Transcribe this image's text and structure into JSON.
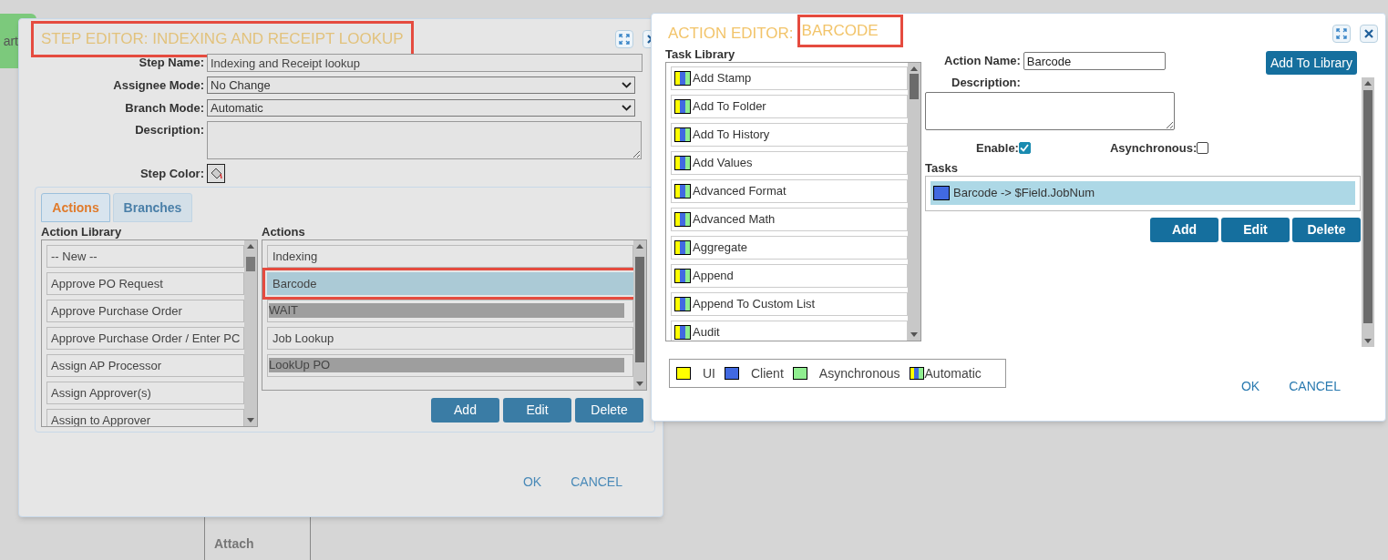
{
  "canvas": {
    "nodes": [
      {
        "kind": "start",
        "label": "art"
      },
      {
        "kind": "step",
        "label": "Attach"
      }
    ]
  },
  "step_editor": {
    "title": "STEP EDITOR: INDEXING AND RECEIPT LOOKUP",
    "title_highlighted": true,
    "fields": [
      {
        "kind": "text",
        "label": "Step Name:",
        "value": "Indexing and Receipt lookup"
      },
      {
        "kind": "select",
        "label": "Assignee Mode:",
        "value": "No Change"
      },
      {
        "kind": "select",
        "label": "Branch Mode:",
        "value": "Automatic"
      },
      {
        "kind": "textarea",
        "label": "Description:"
      },
      {
        "kind": "color",
        "label": "Step Color:"
      }
    ],
    "tabs": [
      {
        "label": "Actions",
        "selected": true
      },
      {
        "label": "Branches",
        "selected": false
      }
    ],
    "action_library": {
      "title": "Action Library",
      "items": [
        "-- New --",
        "Approve PO Request",
        "Approve Purchase Order",
        "Approve Purchase Order / Enter PC",
        "Assign AP Processor",
        "Assign Approver(s)",
        "Assign to Approver"
      ]
    },
    "actions": {
      "title": "Actions",
      "items": [
        {
          "label": "Indexing",
          "selected": false,
          "disabled": false,
          "highlighted": false
        },
        {
          "label": "Barcode",
          "selected": true,
          "disabled": false,
          "highlighted": true
        },
        {
          "label": "WAIT",
          "selected": false,
          "disabled": true,
          "highlighted": false
        },
        {
          "label": "Job Lookup",
          "selected": false,
          "disabled": false,
          "highlighted": false
        },
        {
          "label": "LookUp PO",
          "selected": false,
          "disabled": true,
          "highlighted": false
        }
      ]
    },
    "buttons": [
      "Add",
      "Edit",
      "Delete"
    ],
    "footer": [
      "OK",
      "CANCEL"
    ]
  },
  "action_editor": {
    "title_prefix": "ACTION EDITOR:",
    "title_name": "BARCODE",
    "name_highlighted": true,
    "task_library": {
      "title": "Task Library",
      "items": [
        {
          "label": "Add Stamp",
          "kind": "automatic"
        },
        {
          "label": "Add To Folder",
          "kind": "automatic"
        },
        {
          "label": "Add To History",
          "kind": "automatic"
        },
        {
          "label": "Add Values",
          "kind": "automatic"
        },
        {
          "label": "Advanced Format",
          "kind": "automatic"
        },
        {
          "label": "Advanced Math",
          "kind": "automatic"
        },
        {
          "label": "Aggregate",
          "kind": "automatic"
        },
        {
          "label": "Append",
          "kind": "automatic"
        },
        {
          "label": "Append To Custom List",
          "kind": "automatic"
        },
        {
          "label": "Audit",
          "kind": "automatic"
        }
      ]
    },
    "action_name_label": "Action Name:",
    "action_name": "Barcode",
    "add_to_library": "Add To Library",
    "description_label": "Description:",
    "enable": {
      "label": "Enable:",
      "checked": true
    },
    "asynchronous": {
      "label": "Asynchronous:",
      "checked": false
    },
    "tasks": {
      "title": "Tasks",
      "items": [
        {
          "label": "Barcode -> $Field.JobNum",
          "kind": "client",
          "selected": true
        }
      ]
    },
    "buttons": [
      "Add",
      "Edit",
      "Delete"
    ],
    "legend": [
      {
        "label": "UI",
        "kind": "ui"
      },
      {
        "label": "Client",
        "kind": "client"
      },
      {
        "label": "Asynchronous",
        "kind": "asynchronous"
      },
      {
        "label": "Automatic",
        "kind": "automatic"
      }
    ],
    "footer": [
      "OK",
      "CANCEL"
    ]
  }
}
